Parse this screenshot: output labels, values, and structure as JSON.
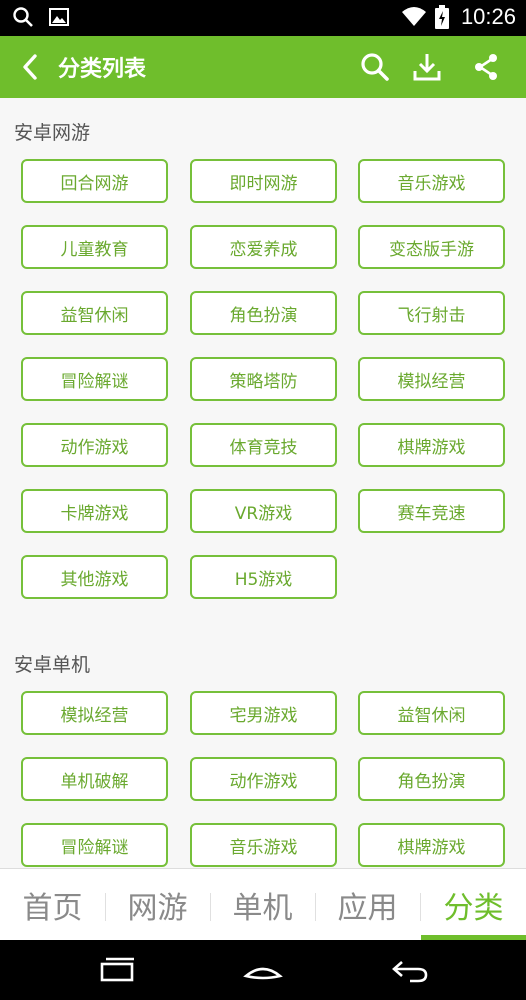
{
  "status_bar": {
    "left_icons": [
      "search-icon",
      "image-icon"
    ],
    "right_icons": [
      "wifi-icon",
      "battery-icon"
    ],
    "time": "10:26"
  },
  "app_bar": {
    "title": "分类列表",
    "actions": [
      "search-icon",
      "download-icon",
      "share-icon"
    ]
  },
  "sections": [
    {
      "title": "安卓网游",
      "tags": [
        "回合网游",
        "即时网游",
        "音乐游戏",
        "儿童教育",
        "恋爱养成",
        "变态版手游",
        "益智休闲",
        "角色扮演",
        "飞行射击",
        "冒险解谜",
        "策略塔防",
        "模拟经营",
        "动作游戏",
        "体育竞技",
        "棋牌游戏",
        "卡牌游戏",
        "VR游戏",
        "赛车竞速",
        "其他游戏",
        "H5游戏"
      ]
    },
    {
      "title": "安卓单机",
      "tags": [
        "模拟经营",
        "宅男游戏",
        "益智休闲",
        "单机破解",
        "动作游戏",
        "角色扮演",
        "冒险解谜",
        "音乐游戏",
        "棋牌游戏"
      ]
    }
  ],
  "tabs": [
    {
      "label": "首页",
      "active": false
    },
    {
      "label": "网游",
      "active": false
    },
    {
      "label": "单机",
      "active": false
    },
    {
      "label": "应用",
      "active": false
    },
    {
      "label": "分类",
      "active": true
    }
  ],
  "nav_bar": [
    "recents-icon",
    "home-icon",
    "back-icon"
  ],
  "colors": {
    "accent": "#6fbe2c",
    "tag_border": "#76c03a",
    "tag_text": "#6aa92f"
  }
}
